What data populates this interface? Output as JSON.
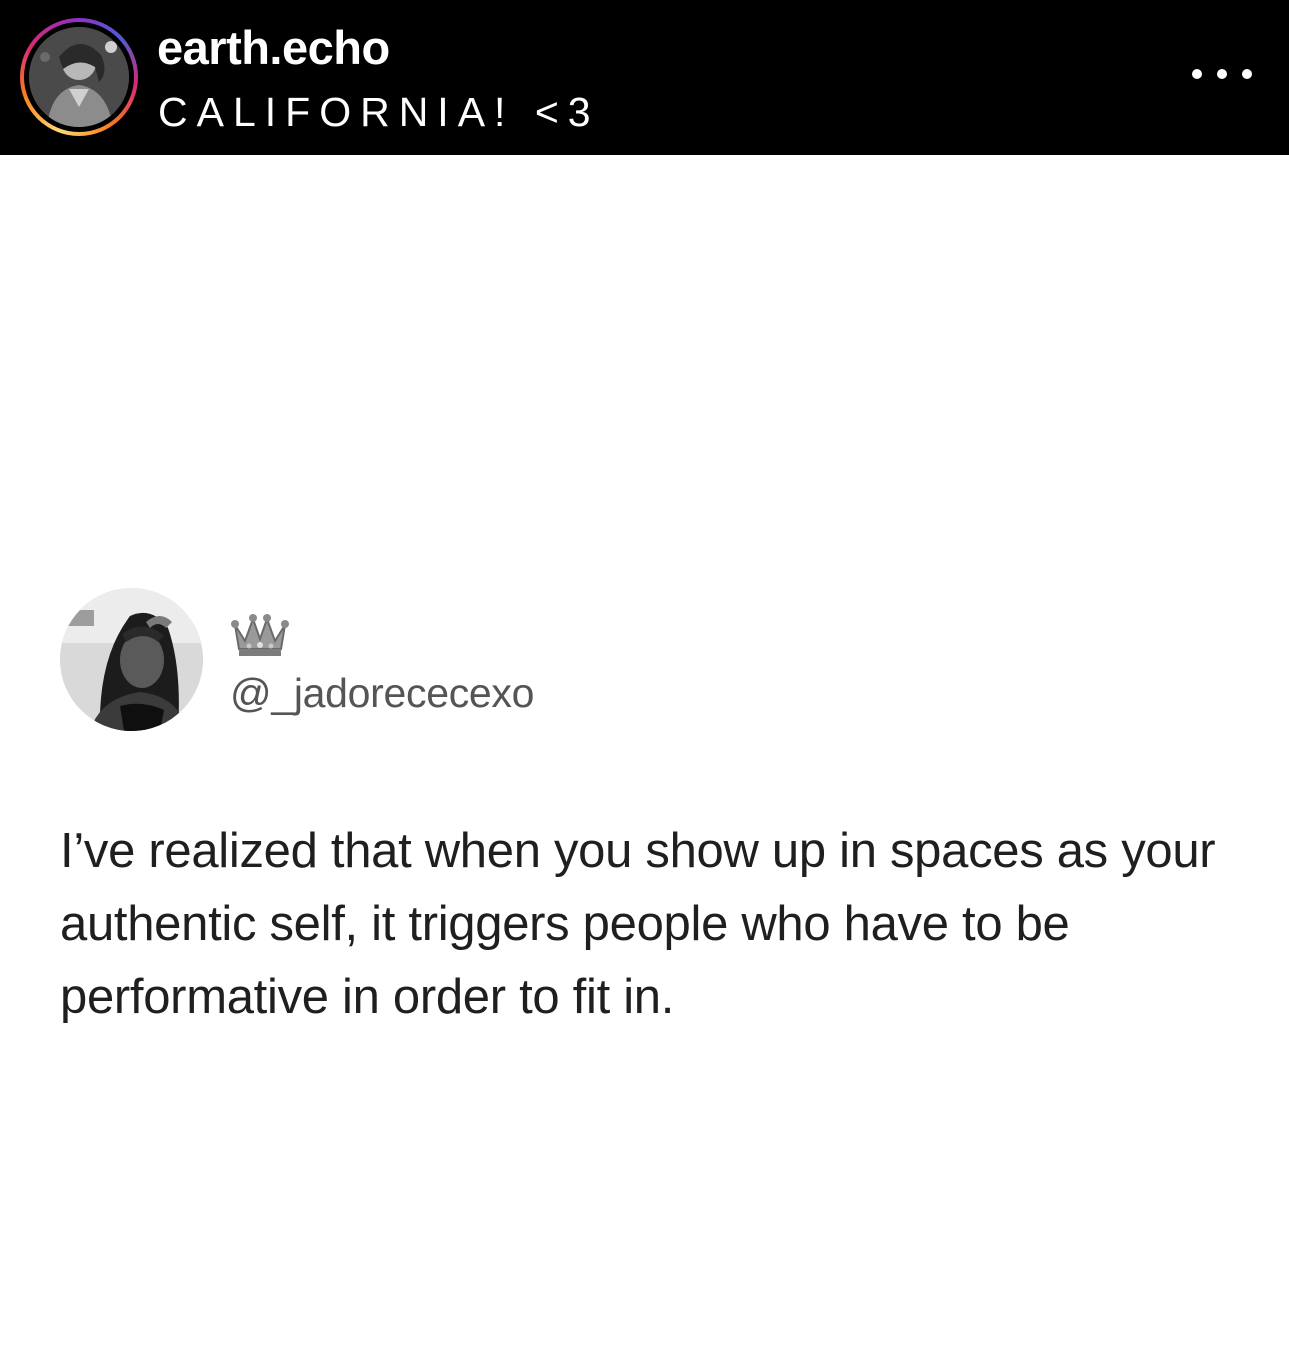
{
  "header": {
    "username": "earth.echo",
    "location": "CALIFORNIA! <3",
    "avatar_icon": "profile-avatar",
    "more_icon": "more-options-icon"
  },
  "tweet": {
    "emoji_icon": "crown-icon",
    "handle": "@_jadorececexo",
    "text": "I’ve realized that when you show up in spaces as your authentic self, it triggers people who have to be performative in order to fit in."
  },
  "colors": {
    "header_background": "#000000",
    "page_background": "#ffffff",
    "tweet_text": "#1f1f1f",
    "handle_text": "#555555"
  }
}
